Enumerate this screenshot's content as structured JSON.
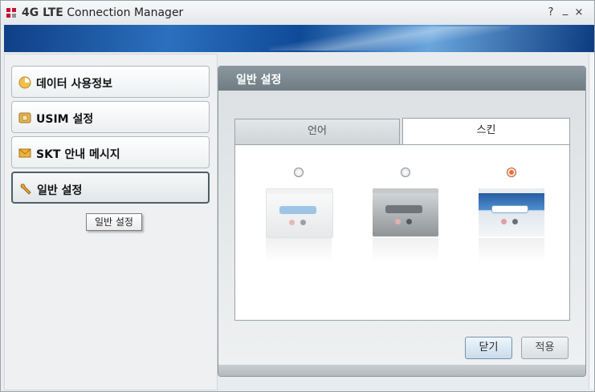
{
  "window": {
    "title_brand": "4G LTE",
    "title_rest": "Connection Manager",
    "help_label": "?",
    "minimize_label": "_",
    "close_label": "×"
  },
  "sidebar": {
    "items": [
      {
        "label": "데이터 사용정보",
        "icon": "data-usage-icon"
      },
      {
        "label": "USIM 설정",
        "icon": "usim-card-icon"
      },
      {
        "label": "SKT 안내 메시지",
        "icon": "envelope-icon"
      },
      {
        "label": "일반 설정",
        "icon": "wrench-icon",
        "active": true
      }
    ],
    "tooltip": "일반 설정"
  },
  "panel": {
    "title": "일반 설정",
    "tabs": [
      {
        "label": "언어",
        "selected": false
      },
      {
        "label": "스킨",
        "selected": true
      }
    ],
    "skins": [
      {
        "selected": false,
        "style": "white"
      },
      {
        "selected": false,
        "style": "gray"
      },
      {
        "selected": true,
        "style": "blue"
      }
    ],
    "buttons": {
      "close_label": "닫기",
      "apply_label": "적용"
    }
  },
  "colors": {
    "brand_red": "#c8102e",
    "banner_blue": "#1c5aa8",
    "panel_header": "#7b878e",
    "radio_selected": "#ff6a2a"
  }
}
